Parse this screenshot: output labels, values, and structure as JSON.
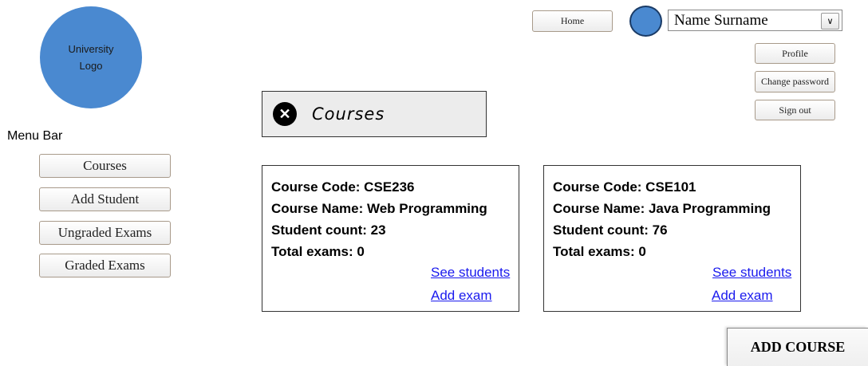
{
  "logo": {
    "line1": "University",
    "line2": "Logo"
  },
  "menu": {
    "title": "Menu Bar",
    "items": [
      {
        "label": "Courses"
      },
      {
        "label": "Add Student"
      },
      {
        "label": "Ungraded Exams"
      },
      {
        "label": "Graded Exams"
      }
    ]
  },
  "topbar": {
    "home_label": "Home",
    "user_name": "Name Surname",
    "dropdown_caret": "∨",
    "user_menu": [
      "Profile",
      "Change password",
      "Sign out"
    ]
  },
  "page": {
    "title": "Courses",
    "close_glyph": "✕"
  },
  "courses": [
    {
      "code_line": "Course Code: CSE236",
      "name_line": "Course Name: Web Programming",
      "students_line": "Student count: 23",
      "exams_line": "Total exams: 0",
      "see_students": "See students",
      "add_exam": "Add exam"
    },
    {
      "code_line": "Course Code: CSE101",
      "name_line": "Course Name: Java Programming",
      "students_line": "Student count: 76",
      "exams_line": "Total exams: 0",
      "see_students": "See students",
      "add_exam": "Add exam"
    }
  ],
  "add_course_label": "ADD COURSE",
  "colors": {
    "logo_blue": "#4a89d0",
    "link_blue": "#1a1aee"
  }
}
